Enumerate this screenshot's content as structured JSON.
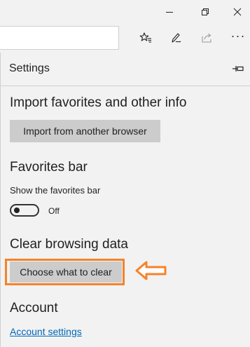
{
  "window": {
    "minimize_icon": "minimize-icon",
    "restore_icon": "restore-icon",
    "close_icon": "close-icon"
  },
  "toolbar": {
    "address_value": "",
    "icons": [
      "favorites-star-icon",
      "web-note-pen-icon",
      "share-icon",
      "more-ellipsis-icon"
    ],
    "more_label": "···"
  },
  "settings": {
    "title": "Settings",
    "pin_icon": "pin-icon",
    "import_section": {
      "heading": "Import favorites and other info",
      "button_label": "Import from another browser"
    },
    "favorites_bar_section": {
      "heading": "Favorites bar",
      "toggle_label": "Show the favorites bar",
      "toggle_state": "Off",
      "toggle_on": false
    },
    "clear_section": {
      "heading": "Clear browsing data",
      "button_label": "Choose what to clear"
    },
    "account_section": {
      "heading": "Account",
      "link_label": "Account settings"
    }
  },
  "annotation": {
    "highlight_color": "#f5832a",
    "arrow_icon": "left-arrow-callout-icon"
  },
  "colors": {
    "panel_bg": "#f2f2f2",
    "button_bg": "#cccccc",
    "link": "#0067b8",
    "accent_orange": "#f5832a"
  }
}
